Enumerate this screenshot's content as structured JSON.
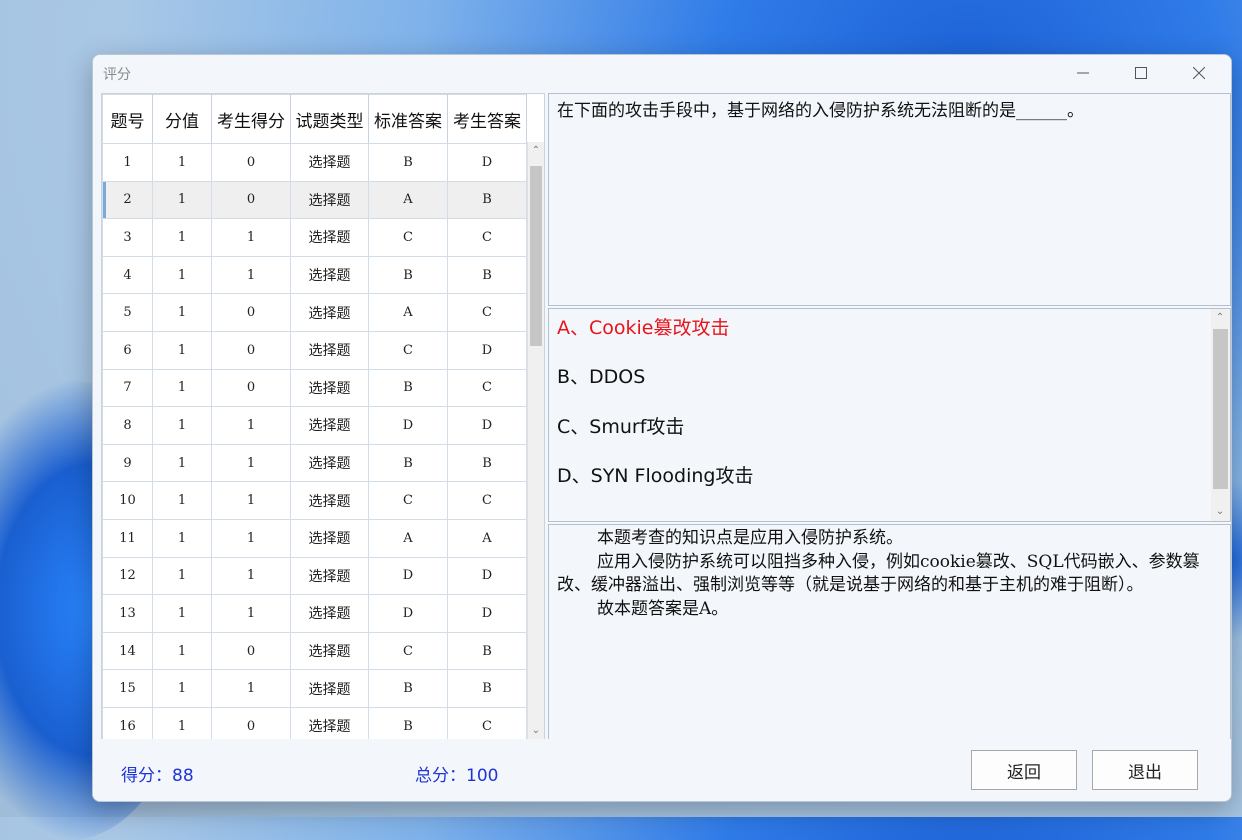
{
  "window": {
    "title": "评分"
  },
  "table": {
    "headers": [
      "题号",
      "分值",
      "考生得分",
      "试题类型",
      "标准答案",
      "考生答案"
    ],
    "rows": [
      [
        "1",
        "1",
        "0",
        "选择题",
        "B",
        "D"
      ],
      [
        "2",
        "1",
        "0",
        "选择题",
        "A",
        "B"
      ],
      [
        "3",
        "1",
        "1",
        "选择题",
        "C",
        "C"
      ],
      [
        "4",
        "1",
        "1",
        "选择题",
        "B",
        "B"
      ],
      [
        "5",
        "1",
        "0",
        "选择题",
        "A",
        "C"
      ],
      [
        "6",
        "1",
        "0",
        "选择题",
        "C",
        "D"
      ],
      [
        "7",
        "1",
        "0",
        "选择题",
        "B",
        "C"
      ],
      [
        "8",
        "1",
        "1",
        "选择题",
        "D",
        "D"
      ],
      [
        "9",
        "1",
        "1",
        "选择题",
        "B",
        "B"
      ],
      [
        "10",
        "1",
        "1",
        "选择题",
        "C",
        "C"
      ],
      [
        "11",
        "1",
        "1",
        "选择题",
        "A",
        "A"
      ],
      [
        "12",
        "1",
        "1",
        "选择题",
        "D",
        "D"
      ],
      [
        "13",
        "1",
        "1",
        "选择题",
        "D",
        "D"
      ],
      [
        "14",
        "1",
        "0",
        "选择题",
        "C",
        "B"
      ],
      [
        "15",
        "1",
        "1",
        "选择题",
        "B",
        "B"
      ],
      [
        "16",
        "1",
        "0",
        "选择题",
        "B",
        "C"
      ]
    ],
    "selected_row": 2
  },
  "question": {
    "text": "在下面的攻击手段中，基于网络的入侵防护系统无法阻断的是______。"
  },
  "options": [
    {
      "text": "A、Cookie篡改攻击",
      "highlight_color": "#e8141a"
    },
    {
      "text": "B、DDOS"
    },
    {
      "text": "C、Smurf攻击"
    },
    {
      "text": "D、SYN Flooding攻击"
    }
  ],
  "explanation": {
    "line1": "本题考查的知识点是应用入侵防护系统。",
    "line2": "应用入侵防护系统可以阻挡多种入侵，例如cookie篡改、SQL代码嵌入、参数篡改、缓冲器溢出、强制浏览等等（就是说基于网络的和基于主机的难于阻断）。",
    "line3": "故本题答案是A。"
  },
  "footer": {
    "score_label": "得分：88",
    "total_label": "总分：100",
    "back_label": "返回",
    "exit_label": "退出"
  },
  "icons": {
    "minimize": "minimize-icon",
    "maximize": "maximize-icon",
    "close": "close-icon",
    "scroll_up": "chevron-up-icon",
    "scroll_down": "chevron-down-icon"
  },
  "colors": {
    "score_text": "#1f35d6",
    "correct_option": "#e8141a"
  }
}
